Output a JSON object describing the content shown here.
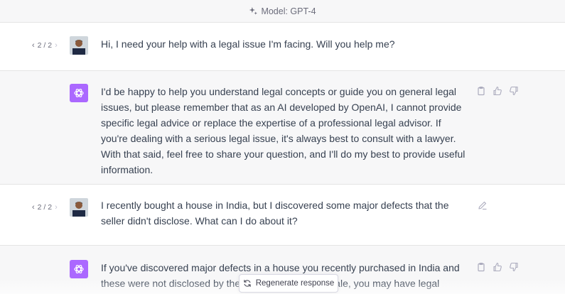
{
  "header": {
    "model_label": "Model: GPT-4"
  },
  "messages": [
    {
      "role": "user",
      "pager": "2 / 2",
      "text": "Hi, I need your help with a legal issue I'm facing. Will you help me?"
    },
    {
      "role": "assistant",
      "text": "I'd be happy to help you understand legal concepts or guide you on general legal issues, but please remember that as an AI developed by OpenAI, I cannot provide specific legal advice or replace the expertise of a professional legal advisor. If you're dealing with a serious legal issue, it's always best to consult with a lawyer. With that said, feel free to share your question, and I'll do my best to provide useful information."
    },
    {
      "role": "user",
      "pager": "2 / 2",
      "text": "I recently bought a house in India, but I discovered some major defects that the seller didn't disclose. What can I do about it?"
    },
    {
      "role": "assistant",
      "text": "If you've discovered major defects in a house you recently purchased in India and these were not disclosed by the seller at the time of sale, you may have legal recourse under Indian"
    }
  ],
  "regenerate": {
    "label": "Regenerate response"
  },
  "colors": {
    "assistant_avatar": "#ab68ff",
    "assistant_bg": "#f7f7f8",
    "border": "#e5e5e5"
  },
  "icons": [
    "sparkle-icon",
    "chevron-left-icon",
    "chevron-right-icon",
    "clipboard-icon",
    "thumbs-up-icon",
    "thumbs-down-icon",
    "edit-icon",
    "refresh-icon"
  ]
}
